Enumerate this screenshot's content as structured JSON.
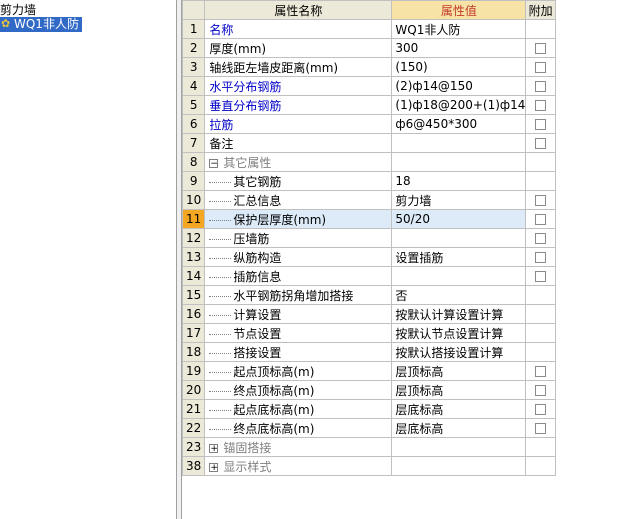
{
  "tree": {
    "root_label": "剪力墙",
    "node_label": "WQ1非人防"
  },
  "grid": {
    "headers": {
      "name": "属性名称",
      "value": "属性值",
      "extra": "附加"
    },
    "rows": [
      {
        "num": "1",
        "name": "名称",
        "value": "WQ1非人防",
        "style": "blue",
        "checkbox": false
      },
      {
        "num": "2",
        "name": "厚度(mm)",
        "value": "300",
        "style": "normal",
        "checkbox": true
      },
      {
        "num": "3",
        "name": "轴线距左墙皮距离(mm)",
        "value": "(150)",
        "style": "normal",
        "checkbox": true
      },
      {
        "num": "4",
        "name": "水平分布钢筋",
        "value": "(2)ф14@150",
        "style": "blue",
        "checkbox": true
      },
      {
        "num": "5",
        "name": "垂直分布钢筋",
        "value": "(1)ф18@200+(1)ф14",
        "style": "blue",
        "checkbox": true
      },
      {
        "num": "6",
        "name": "拉筋",
        "value": "ф6@450*300",
        "style": "blue",
        "checkbox": true
      },
      {
        "num": "7",
        "name": "备注",
        "value": "",
        "style": "normal",
        "checkbox": true
      },
      {
        "num": "8",
        "name": "其它属性",
        "value": "",
        "style": "group",
        "expander": "−",
        "checkbox": false
      },
      {
        "num": "9",
        "name": "其它钢筋",
        "value": "18",
        "style": "child",
        "checkbox": false
      },
      {
        "num": "10",
        "name": "汇总信息",
        "value": "剪力墙",
        "style": "child",
        "checkbox": true
      },
      {
        "num": "11",
        "name": "保护层厚度(mm)",
        "value": "50/20",
        "style": "child",
        "checkbox": true,
        "selected": true
      },
      {
        "num": "12",
        "name": "压墙筋",
        "value": "",
        "style": "child",
        "checkbox": true
      },
      {
        "num": "13",
        "name": "纵筋构造",
        "value": "设置插筋",
        "style": "child",
        "checkbox": true
      },
      {
        "num": "14",
        "name": "插筋信息",
        "value": "",
        "style": "child",
        "checkbox": true
      },
      {
        "num": "15",
        "name": "水平钢筋拐角增加搭接",
        "value": "否",
        "style": "child",
        "checkbox": false
      },
      {
        "num": "16",
        "name": "计算设置",
        "value": "按默认计算设置计算",
        "style": "child",
        "checkbox": false
      },
      {
        "num": "17",
        "name": "节点设置",
        "value": "按默认节点设置计算",
        "style": "child",
        "checkbox": false
      },
      {
        "num": "18",
        "name": "搭接设置",
        "value": "按默认搭接设置计算",
        "style": "child",
        "checkbox": false
      },
      {
        "num": "19",
        "name": "起点顶标高(m)",
        "value": "层顶标高",
        "style": "child",
        "checkbox": true
      },
      {
        "num": "20",
        "name": "终点顶标高(m)",
        "value": "层顶标高",
        "style": "child",
        "checkbox": true
      },
      {
        "num": "21",
        "name": "起点底标高(m)",
        "value": "层底标高",
        "style": "child",
        "checkbox": true
      },
      {
        "num": "22",
        "name": "终点底标高(m)",
        "value": "层底标高",
        "style": "child",
        "checkbox": true
      },
      {
        "num": "23",
        "name": "锚固搭接",
        "value": "",
        "style": "group",
        "expander": "+",
        "checkbox": false
      },
      {
        "num": "38",
        "name": "显示样式",
        "value": "",
        "style": "group",
        "expander": "+",
        "checkbox": false
      }
    ]
  },
  "colors": {
    "header_bg": "#ece9d8",
    "selected_row_num": "#f5a623",
    "tree_selection": "#3169c6",
    "blue_text": "#0000c8"
  }
}
